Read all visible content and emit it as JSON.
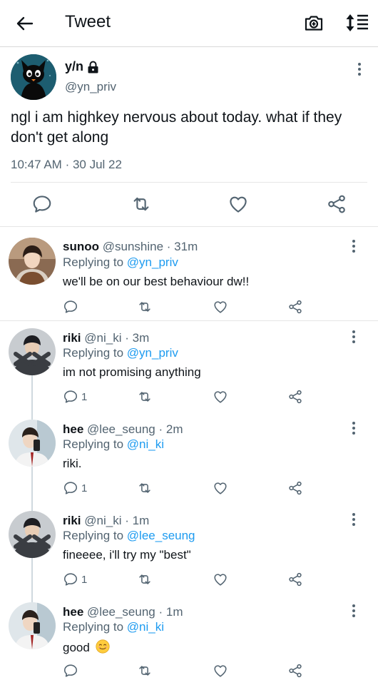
{
  "header": {
    "title": "Tweet"
  },
  "main_tweet": {
    "name": "y/n",
    "handle": "@yn_priv",
    "text": "ngl i am highkey nervous about today. what if they don't get along",
    "time": "10:47 AM",
    "dot": "·",
    "date": "30 Jul 22"
  },
  "replies": [
    {
      "name": "sunoo",
      "handle": "@sunshine",
      "time": "· 31m",
      "replying_label": "Replying to",
      "replying_to": "@yn_priv",
      "text": "we'll be on our best behaviour dw!!",
      "reply_count": ""
    },
    {
      "name": "riki",
      "handle": "@ni_ki",
      "time": "· 3m",
      "replying_label": "Replying to",
      "replying_to": "@yn_priv",
      "text": "im not promising anything",
      "reply_count": "1"
    },
    {
      "name": "hee",
      "handle": "@lee_seung",
      "time": "· 2m",
      "replying_label": "Replying to",
      "replying_to": "@ni_ki",
      "text": "riki.",
      "reply_count": "1"
    },
    {
      "name": "riki",
      "handle": "@ni_ki",
      "time": "· 1m",
      "replying_label": "Replying to",
      "replying_to": "@lee_seung",
      "text": "fineeee, i'll try my \"best\"",
      "reply_count": "1"
    },
    {
      "name": "hee",
      "handle": "@lee_seung",
      "time": "· 1m",
      "replying_label": "Replying to",
      "replying_to": "@ni_ki",
      "text": "good",
      "reply_count": ""
    }
  ],
  "icons": {
    "back": "arrow-left-icon",
    "camera": "camera-plus-icon",
    "sort": "sort-list-icon",
    "reply": "comment-icon",
    "retweet": "retweet-icon",
    "like": "heart-icon",
    "share": "share-nodes-icon",
    "lock": "lock-icon",
    "more": "more-vertical-icon",
    "emoji": "smiling-face-emoji"
  },
  "colors": {
    "link": "#1d9bf0",
    "muted": "#536471",
    "text": "#0f1419",
    "divider": "#e6e6e6"
  }
}
